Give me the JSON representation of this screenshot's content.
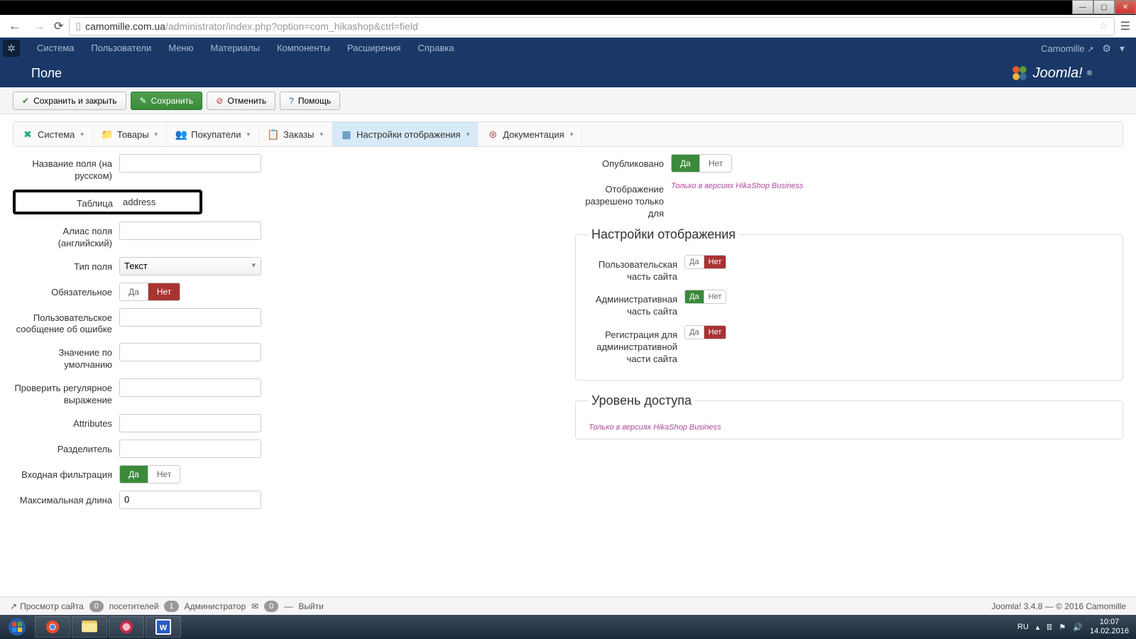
{
  "browser": {
    "url_domain": "camomille.com.ua",
    "url_path": "/administrator/index.php?option=com_hikashop&ctrl=field"
  },
  "joomla_nav": {
    "items": [
      "Система",
      "Пользователи",
      "Меню",
      "Материалы",
      "Компоненты",
      "Расширения",
      "Справка"
    ],
    "site_name": "Camomille",
    "page_title": "Поле",
    "brand": "Joomla!"
  },
  "toolbar": {
    "save_close": "Сохранить и закрыть",
    "save": "Сохранить",
    "cancel": "Отменить",
    "help": "Помощь"
  },
  "subtabs": {
    "system": "Система",
    "products": "Товары",
    "customers": "Покупатели",
    "orders": "Заказы",
    "display": "Настройки отображения",
    "docs": "Документация"
  },
  "left": {
    "name_label": "Название поля (на русском)",
    "name_value": "",
    "table_label": "Таблица",
    "table_value": "address",
    "alias_label": "Алиас поля (английский)",
    "alias_value": "",
    "type_label": "Тип поля",
    "type_value": "Текст",
    "required_label": "Обязательное",
    "error_label": "Пользовательское сообщение об ошибке",
    "error_value": "",
    "default_label": "Значение по умолчанию",
    "default_value": "",
    "regex_label": "Проверить регулярное выражение",
    "regex_value": "",
    "attributes_label": "Attributes",
    "attributes_value": "",
    "separator_label": "Разделитель",
    "separator_value": "",
    "filter_label": "Входная фильтрация",
    "maxlen_label": "Максимальная длина",
    "maxlen_value": "0"
  },
  "right": {
    "published_label": "Опубликовано",
    "allowed_label": "Отображение разрешено только для",
    "business_note": "Только в версиях HikaShop Business",
    "display_legend": "Настройки отображения",
    "frontend_label": "Пользовательская часть сайта",
    "backend_label": "Административная часть сайта",
    "reg_backend_label": "Регистрация для административной части сайта",
    "access_legend": "Уровень доступа"
  },
  "radio": {
    "yes": "Да",
    "no": "Нет"
  },
  "statusbar": {
    "view_site": "Просмотр сайта",
    "visitors_count": "0",
    "visitors": "посетителей",
    "admin_count": "1",
    "admin": "Администратор",
    "msg_count": "0",
    "logout": "Выйти",
    "footer": "Joomla! 3.4.8 — © 2016 Camomille"
  },
  "taskbar": {
    "lang": "RU",
    "time": "10:07",
    "date": "14.02.2016"
  }
}
